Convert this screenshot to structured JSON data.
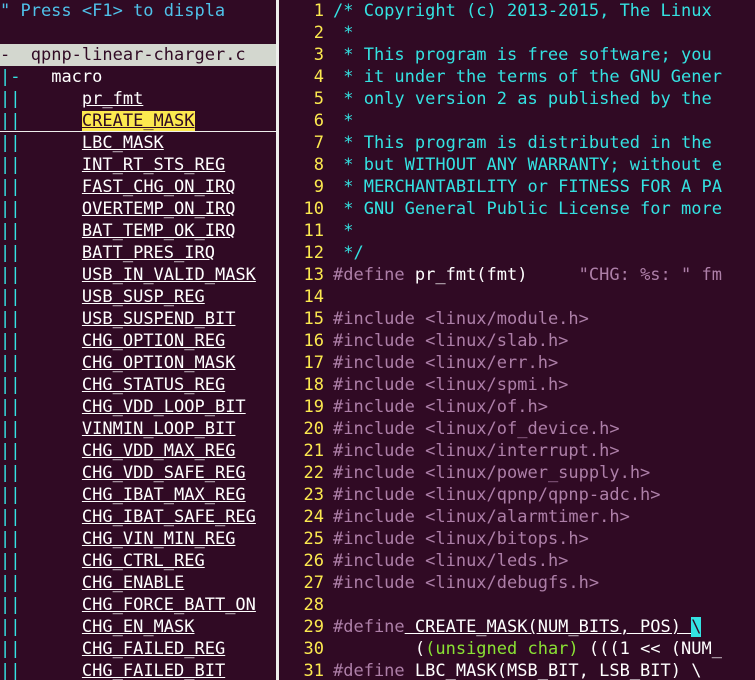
{
  "tagbar": {
    "help_text": "\" Press <F1> to displa",
    "file_marker": "-",
    "file_name": "qpnp-linear-charger.c",
    "group_marker": "|-",
    "group_name": "macro",
    "tags": [
      "pr_fmt",
      "CREATE_MASK",
      "LBC_MASK",
      "INT_RT_STS_REG",
      "FAST_CHG_ON_IRQ",
      "OVERTEMP_ON_IRQ",
      "BAT_TEMP_OK_IRQ",
      "BATT_PRES_IRQ",
      "USB_IN_VALID_MASK",
      "USB_SUSP_REG",
      "USB_SUSPEND_BIT",
      "CHG_OPTION_REG",
      "CHG_OPTION_MASK",
      "CHG_STATUS_REG",
      "CHG_VDD_LOOP_BIT",
      "VINMIN_LOOP_BIT",
      "CHG_VDD_MAX_REG",
      "CHG_VDD_SAFE_REG",
      "CHG_IBAT_MAX_REG",
      "CHG_IBAT_SAFE_REG",
      "CHG_VIN_MIN_REG",
      "CHG_CTRL_REG",
      "CHG_ENABLE",
      "CHG_FORCE_BATT_ON",
      "CHG_EN_MASK",
      "CHG_FAILED_REG",
      "CHG_FAILED_BIT"
    ],
    "selected_tag": "CREATE_MASK"
  },
  "editor": {
    "lines": [
      {
        "n": "1",
        "text": "/* Copyright (c) 2013-2015, The Linux "
      },
      {
        "n": "2",
        "text": " *"
      },
      {
        "n": "3",
        "text": " * This program is free software; you "
      },
      {
        "n": "4",
        "text": " * it under the terms of the GNU Gener"
      },
      {
        "n": "5",
        "text": " * only version 2 as published by the "
      },
      {
        "n": "6",
        "text": " *"
      },
      {
        "n": "7",
        "text": " * This program is distributed in the "
      },
      {
        "n": "8",
        "text": " * but WITHOUT ANY WARRANTY; without e"
      },
      {
        "n": "9",
        "text": " * MERCHANTABILITY or FITNESS FOR A PA"
      },
      {
        "n": "10",
        "text": " * GNU General Public License for more"
      },
      {
        "n": "11",
        "text": " *"
      },
      {
        "n": "12",
        "text": " */"
      },
      {
        "n": "13",
        "directive": "#define",
        "rest": " pr_fmt(fmt)     ",
        "string": "\"CHG: %s: \" fm"
      },
      {
        "n": "14",
        "text": ""
      },
      {
        "n": "15",
        "directive": "#include",
        "include": " <linux/module.h>"
      },
      {
        "n": "16",
        "directive": "#include",
        "include": " <linux/slab.h>"
      },
      {
        "n": "17",
        "directive": "#include",
        "include": " <linux/err.h>"
      },
      {
        "n": "18",
        "directive": "#include",
        "include": " <linux/spmi.h>"
      },
      {
        "n": "19",
        "directive": "#include",
        "include": " <linux/of.h>"
      },
      {
        "n": "20",
        "directive": "#include",
        "include": " <linux/of_device.h>"
      },
      {
        "n": "21",
        "directive": "#include",
        "include": " <linux/interrupt.h>"
      },
      {
        "n": "22",
        "directive": "#include",
        "include": " <linux/power_supply.h>"
      },
      {
        "n": "23",
        "directive": "#include",
        "include": " <linux/qpnp/qpnp-adc.h>"
      },
      {
        "n": "24",
        "directive": "#include",
        "include": " <linux/alarmtimer.h>"
      },
      {
        "n": "25",
        "directive": "#include",
        "include": " <linux/bitops.h>"
      },
      {
        "n": "26",
        "directive": "#include",
        "include": " <linux/leds.h>"
      },
      {
        "n": "27",
        "directive": "#include",
        "include": " <linux/debugfs.h>"
      },
      {
        "n": "28",
        "text": ""
      },
      {
        "n": "29",
        "directive": "#define",
        "rest": " CREATE_MASK(NUM_BITS, POS) ",
        "cursor": "\\"
      },
      {
        "n": "30",
        "indent": "        (",
        "type": "(unsigned char)",
        "tail": " (((1 << (NUM_"
      },
      {
        "n": "31",
        "directive": "#define",
        "rest": " LBC_MASK(MSB_BIT, LSB_BIT) \\"
      }
    ]
  },
  "colors": {
    "background": "#300a24",
    "line_number": "#fce94f",
    "comment": "#34e2e2",
    "preproc": "#ad7fa8",
    "type": "#8ae234",
    "selection": "#fce94f"
  }
}
